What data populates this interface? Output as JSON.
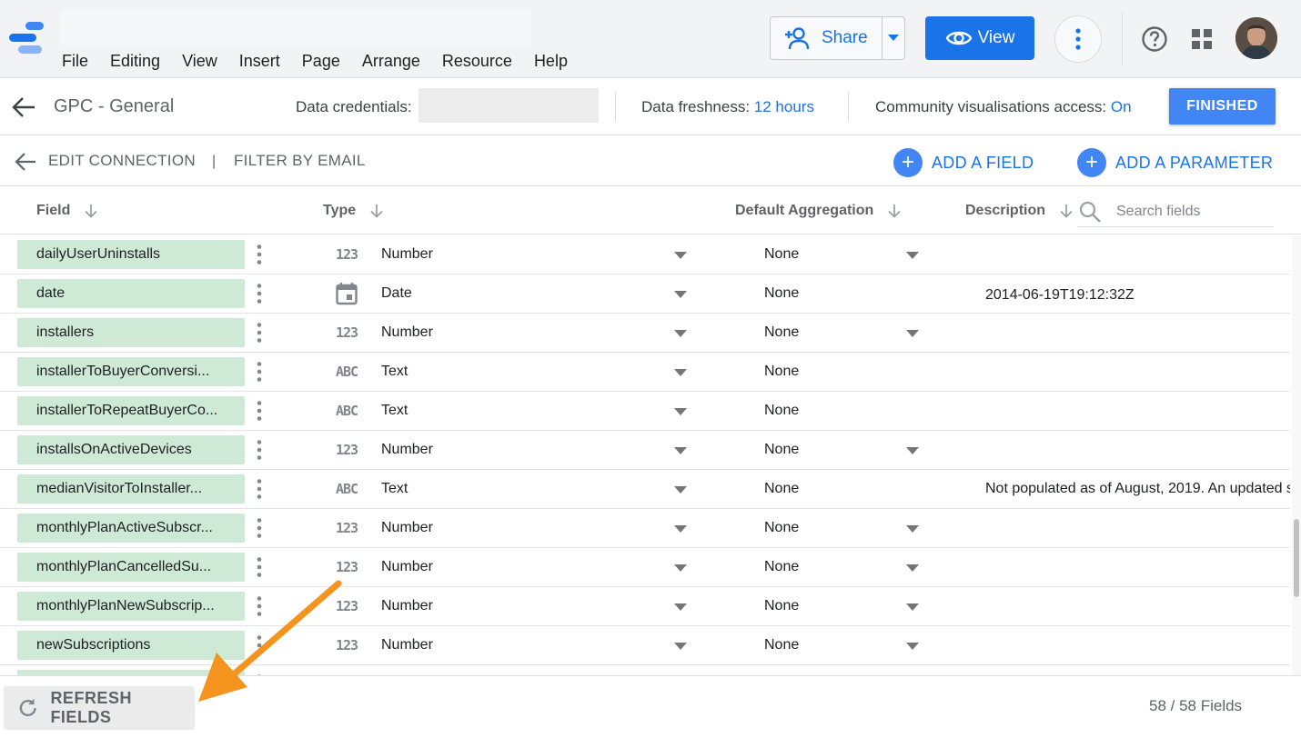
{
  "menu": [
    "File",
    "Editing",
    "View",
    "Insert",
    "Page",
    "Arrange",
    "Resource",
    "Help"
  ],
  "header": {
    "share_label": "Share",
    "view_label": "View"
  },
  "toolbar": {
    "data_source_name": "GPC - General",
    "credentials_label": "Data credentials:",
    "freshness_label": "Data freshness:",
    "freshness_value": "12 hours",
    "community_label": "Community visualisations access:",
    "community_value": "On",
    "finished_label": "FINISHED"
  },
  "subbar": {
    "edit_connection": "EDIT CONNECTION",
    "divider": "|",
    "filter_label": "FILTER BY EMAIL",
    "add_field": "ADD A FIELD",
    "add_parameter": "ADD A PARAMETER"
  },
  "columns": {
    "field": "Field",
    "type": "Type",
    "aggregation": "Default Aggregation",
    "description": "Description",
    "search_placeholder": "Search fields"
  },
  "rows": [
    {
      "field": "dailyUserUninstalls",
      "type_icon": "123",
      "type": "Number",
      "agg": "None",
      "agg_dropdown": true,
      "desc": ""
    },
    {
      "field": "date",
      "type_icon": "calendar",
      "type": "Date",
      "agg": "None",
      "agg_dropdown": false,
      "desc": "2014-06-19T19:12:32Z"
    },
    {
      "field": "installers",
      "type_icon": "123",
      "type": "Number",
      "agg": "None",
      "agg_dropdown": true,
      "desc": ""
    },
    {
      "field": "installerToBuyerConversi...",
      "type_icon": "ABC",
      "type": "Text",
      "agg": "None",
      "agg_dropdown": false,
      "desc": ""
    },
    {
      "field": "installerToRepeatBuyerCo...",
      "type_icon": "ABC",
      "type": "Text",
      "agg": "None",
      "agg_dropdown": false,
      "desc": ""
    },
    {
      "field": "installsOnActiveDevices",
      "type_icon": "123",
      "type": "Number",
      "agg": "None",
      "agg_dropdown": true,
      "desc": ""
    },
    {
      "field": "medianVisitorToInstaller...",
      "type_icon": "ABC",
      "type": "Text",
      "agg": "None",
      "agg_dropdown": false,
      "desc": "Not populated as of August, 2019. An updated s"
    },
    {
      "field": "monthlyPlanActiveSubscr...",
      "type_icon": "123",
      "type": "Number",
      "agg": "None",
      "agg_dropdown": true,
      "desc": ""
    },
    {
      "field": "monthlyPlanCancelledSu...",
      "type_icon": "123",
      "type": "Number",
      "agg": "None",
      "agg_dropdown": true,
      "desc": ""
    },
    {
      "field": "monthlyPlanNewSubscrip...",
      "type_icon": "123",
      "type": "Number",
      "agg": "None",
      "agg_dropdown": true,
      "desc": ""
    },
    {
      "field": "newSubscriptions",
      "type_icon": "123",
      "type": "Number",
      "agg": "None",
      "agg_dropdown": true,
      "desc": ""
    },
    {
      "field": "",
      "type_icon": "",
      "type": "",
      "agg": "",
      "agg_dropdown": false,
      "desc": ""
    }
  ],
  "footer": {
    "refresh_label": "REFRESH FIELDS",
    "field_count": "58 / 58 Fields"
  },
  "colors": {
    "accent": "#1a73e8",
    "primary_button": "#4285f4",
    "chip": "#ceead6",
    "annotation_arrow": "#f4941f"
  }
}
